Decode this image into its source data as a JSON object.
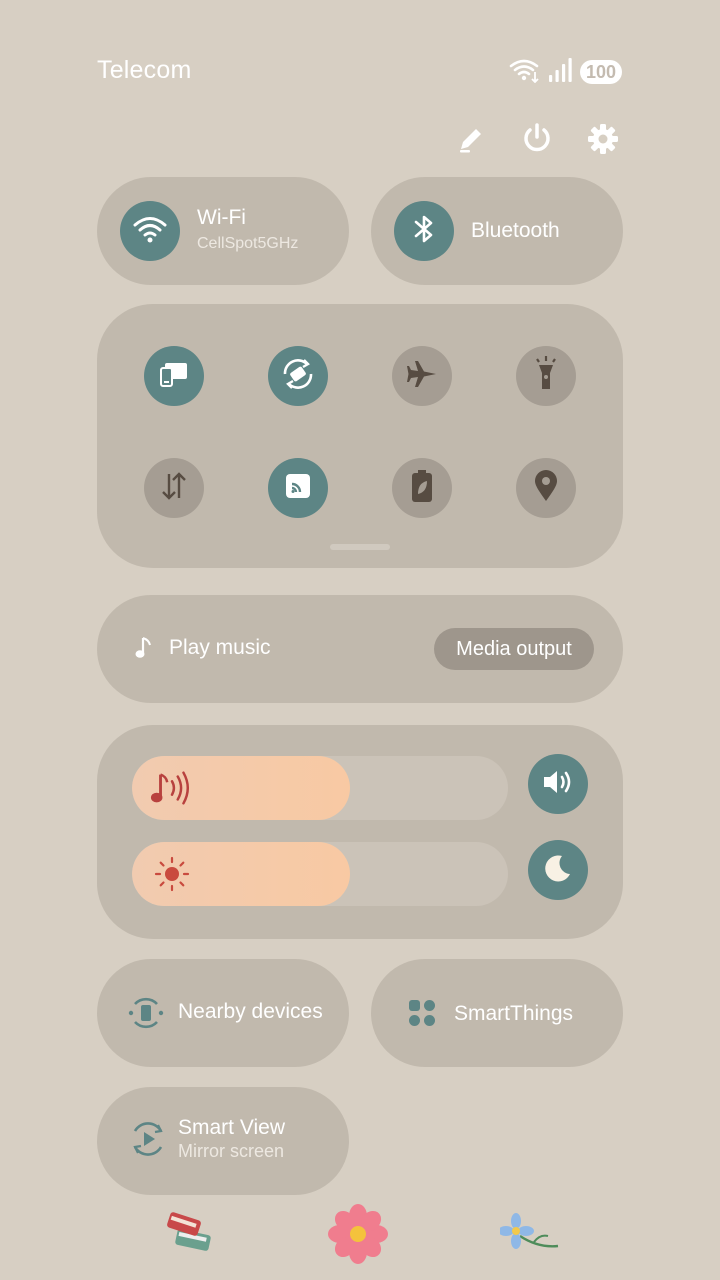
{
  "status_bar": {
    "carrier": "Telecom",
    "battery": "100"
  },
  "top_actions": {
    "edit_icon": "pencil-icon",
    "power_icon": "power-icon",
    "settings_icon": "gear-icon"
  },
  "connectivity": {
    "wifi": {
      "title": "Wi-Fi",
      "network": "CellSpot5GHz",
      "enabled": true
    },
    "bluetooth": {
      "title": "Bluetooth",
      "enabled": true
    }
  },
  "tiles": [
    {
      "icon": "device-connect-icon",
      "enabled": true
    },
    {
      "icon": "auto-rotate-icon",
      "enabled": true
    },
    {
      "icon": "airplane-icon",
      "enabled": false
    },
    {
      "icon": "flashlight-icon",
      "enabled": false
    },
    {
      "icon": "mobile-data-icon",
      "enabled": false
    },
    {
      "icon": "cast-icon",
      "enabled": true
    },
    {
      "icon": "power-saving-icon",
      "enabled": false
    },
    {
      "icon": "location-icon",
      "enabled": false
    }
  ],
  "media": {
    "play_label": "Play music",
    "output_label": "Media output"
  },
  "sliders": {
    "volume": {
      "level_percent": 58,
      "icon": "music-volume-icon"
    },
    "brightness": {
      "level_percent": 58,
      "icon": "sun-icon"
    }
  },
  "shortcuts": {
    "nearby": "Nearby devices",
    "smartthings": "SmartThings",
    "smart_view_title": "Smart View",
    "smart_view_sub": "Mirror screen"
  },
  "colors": {
    "background": "#d7cfc3",
    "card": "#c1b9ad",
    "accent_teal": "#5d8585",
    "inactive": "#a59d93",
    "slider_fill": "#f8c9a3"
  }
}
